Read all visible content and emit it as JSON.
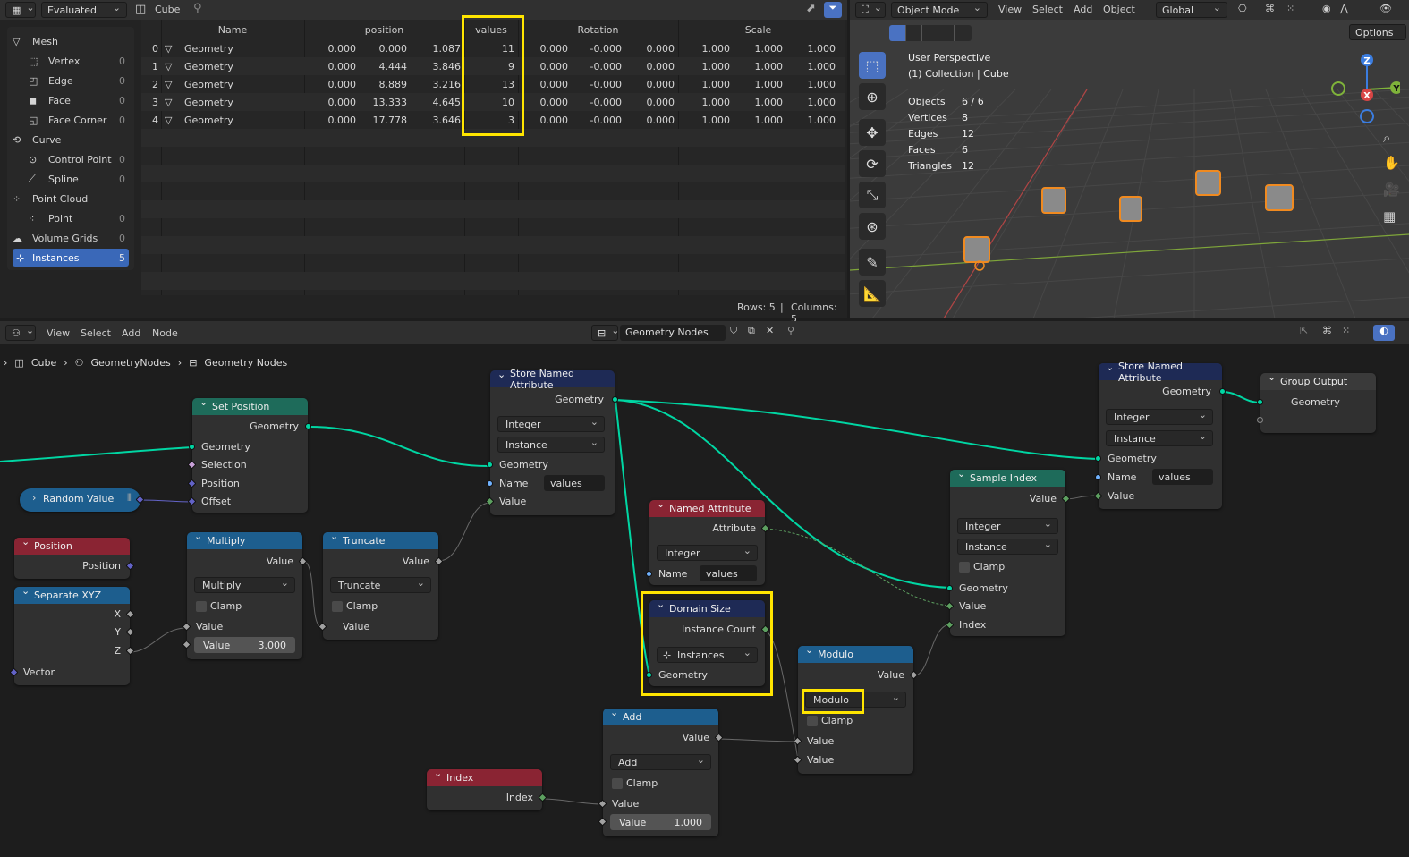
{
  "spreadsheet": {
    "display_mode": "Evaluated",
    "object": "Cube",
    "sidebar": [
      {
        "label": "Mesh",
        "count": ""
      },
      {
        "label": "Vertex",
        "count": "0"
      },
      {
        "label": "Edge",
        "count": "0"
      },
      {
        "label": "Face",
        "count": "0"
      },
      {
        "label": "Face Corner",
        "count": "0"
      },
      {
        "label": "Curve",
        "count": ""
      },
      {
        "label": "Control Point",
        "count": "0"
      },
      {
        "label": "Spline",
        "count": "0"
      },
      {
        "label": "Point Cloud",
        "count": ""
      },
      {
        "label": "Point",
        "count": "0"
      },
      {
        "label": "Volume Grids",
        "count": "0"
      },
      {
        "label": "Instances",
        "count": "5"
      }
    ],
    "columns": [
      "Name",
      "position",
      "values",
      "Rotation",
      "Scale"
    ],
    "rows": [
      {
        "idx": "0",
        "name": "Geometry",
        "pos": [
          "0.000",
          "0.000",
          "1.087"
        ],
        "val": "11",
        "rot": [
          "0.000",
          "-0.000",
          "0.000"
        ],
        "scale": [
          "1.000",
          "1.000",
          "1.000"
        ]
      },
      {
        "idx": "1",
        "name": "Geometry",
        "pos": [
          "0.000",
          "4.444",
          "3.846"
        ],
        "val": "9",
        "rot": [
          "0.000",
          "-0.000",
          "0.000"
        ],
        "scale": [
          "1.000",
          "1.000",
          "1.000"
        ]
      },
      {
        "idx": "2",
        "name": "Geometry",
        "pos": [
          "0.000",
          "8.889",
          "3.216"
        ],
        "val": "13",
        "rot": [
          "0.000",
          "-0.000",
          "0.000"
        ],
        "scale": [
          "1.000",
          "1.000",
          "1.000"
        ]
      },
      {
        "idx": "3",
        "name": "Geometry",
        "pos": [
          "0.000",
          "13.333",
          "4.645"
        ],
        "val": "10",
        "rot": [
          "0.000",
          "-0.000",
          "0.000"
        ],
        "scale": [
          "1.000",
          "1.000",
          "1.000"
        ]
      },
      {
        "idx": "4",
        "name": "Geometry",
        "pos": [
          "0.000",
          "17.778",
          "3.646"
        ],
        "val": "3",
        "rot": [
          "0.000",
          "-0.000",
          "0.000"
        ],
        "scale": [
          "1.000",
          "1.000",
          "1.000"
        ]
      }
    ],
    "rows_label": "Rows: 5",
    "cols_label": "Columns: 5"
  },
  "viewport": {
    "mode": "Object Mode",
    "menu": [
      "View",
      "Select",
      "Add",
      "Object"
    ],
    "orientation": "Global",
    "options": "Options",
    "overlay_title": "User Perspective",
    "overlay_sub": "(1) Collection | Cube",
    "stats": [
      {
        "k": "Objects",
        "v": "6 / 6"
      },
      {
        "k": "Vertices",
        "v": "8"
      },
      {
        "k": "Edges",
        "v": "12"
      },
      {
        "k": "Faces",
        "v": "6"
      },
      {
        "k": "Triangles",
        "v": "12"
      }
    ],
    "axes": {
      "x": "X",
      "y": "Y",
      "z": "Z"
    }
  },
  "node_editor": {
    "menu": [
      "View",
      "Select",
      "Add",
      "Node"
    ],
    "tree_name": "Geometry Nodes",
    "breadcrumb": [
      "Cube",
      "GeometryNodes",
      "Geometry Nodes"
    ]
  },
  "nodes": {
    "set_position": {
      "title": "Set Position",
      "out": "Geometry",
      "inputs": [
        "Geometry",
        "Selection",
        "Position",
        "Offset"
      ]
    },
    "random_value": {
      "title": "Random Value"
    },
    "position": {
      "title": "Position",
      "out": "Position"
    },
    "separate_xyz": {
      "title": "Separate XYZ",
      "outs": [
        "X",
        "Y",
        "Z"
      ],
      "in": "Vector"
    },
    "multiply": {
      "title": "Multiply",
      "out": "Value",
      "op": "Multiply",
      "clamp": "Clamp",
      "in1": "Value",
      "field_label": "Value",
      "field_value": "3.000"
    },
    "truncate": {
      "title": "Truncate",
      "out": "Value",
      "op": "Truncate",
      "clamp": "Clamp",
      "in1": "Value"
    },
    "store1": {
      "title": "Store Named Attribute",
      "out": "Geometry",
      "type": "Integer",
      "domain": "Instance",
      "in_geo": "Geometry",
      "in_name": "Name",
      "name_value": "values",
      "in_value": "Value"
    },
    "named_attr": {
      "title": "Named Attribute",
      "out": "Attribute",
      "type": "Integer",
      "in_name": "Name",
      "name_value": "values"
    },
    "domain_size": {
      "title": "Domain Size",
      "out": "Instance Count",
      "mode": "Instances",
      "in": "Geometry"
    },
    "modulo": {
      "title": "Modulo",
      "out": "Value",
      "op": "Modulo",
      "clamp": "Clamp",
      "in1": "Value",
      "in2": "Value"
    },
    "add": {
      "title": "Add",
      "out": "Value",
      "op": "Add",
      "clamp": "Clamp",
      "in1": "Value",
      "field_label": "Value",
      "field_value": "1.000"
    },
    "index": {
      "title": "Index",
      "out": "Index"
    },
    "sample_index": {
      "title": "Sample Index",
      "out": "Value",
      "type": "Integer",
      "domain": "Instance",
      "clamp": "Clamp",
      "inputs": [
        "Geometry",
        "Value",
        "Index"
      ]
    },
    "store2": {
      "title": "Store Named Attribute",
      "out": "Geometry",
      "type": "Integer",
      "domain": "Instance",
      "in_geo": "Geometry",
      "in_name": "Name",
      "name_value": "values",
      "in_value": "Value"
    },
    "group_output": {
      "title": "Group Output",
      "in": "Geometry"
    }
  },
  "colors": {
    "highlight": "#ffe500",
    "geometry_link": "#00d6a3",
    "selected": "#3a68b8"
  }
}
